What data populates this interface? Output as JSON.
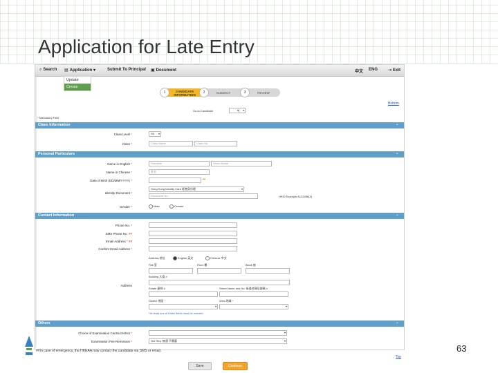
{
  "slide": {
    "title": "Application for Late Entry",
    "page_number": "63"
  },
  "topbar": {
    "search": "Search",
    "application": "Application",
    "submit": "Submit To Principal",
    "document": "Document",
    "lang_zh": "中文",
    "lang_en": "ENG",
    "exit": "Exit"
  },
  "dropdown": {
    "items": [
      "Update",
      "Create"
    ],
    "selected": "Create"
  },
  "stepper": {
    "steps": [
      {
        "num": "1",
        "label": "CANDIDATE INFORMATION"
      },
      {
        "num": "2",
        "label": "SUBJECT"
      },
      {
        "num": "3",
        "label": "REVIEW"
      }
    ]
  },
  "links": {
    "bottom": "Bottom",
    "top": "Top"
  },
  "go_to_candidate": "Go to Candidate",
  "mandatory": "* Mandatory Field",
  "sections": {
    "class_info": "Class Information",
    "personal": "Personal Particulars",
    "contact": "Contact Information",
    "others": "Others"
  },
  "class_info": {
    "class_level_label": "Class Level",
    "class_level_value": "S6",
    "class_label": "Class",
    "class_name_placeholder": "Class Name",
    "class_no_placeholder": "Class No."
  },
  "personal": {
    "name_en_label": "Name in English",
    "surname_placeholder": "Surname",
    "given_placeholder": "Given Name",
    "name_zh_label": "Name in Chinese",
    "name_zh_placeholder": "姓名",
    "dob_label": "Date of Birth (DD/MM/YYYY)",
    "id_doc_label": "Identity Document",
    "id_doc_value": "Hong Kong Identity Card 香港身份證",
    "doc_no_placeholder": "Document No.",
    "hkid_example": "HKID Example A123456(3)",
    "gender_label": "Gender",
    "male": "Male",
    "female": "Female"
  },
  "contact": {
    "phone_label": "Phone No.",
    "sms_label": "SMS Phone No.",
    "email_label": "Email Address",
    "confirm_email_label": "Confirm Email Address",
    "address_label": "Address",
    "address_lang_label": "Address 地址",
    "english": "English 英文",
    "chinese": "Chinese 中文",
    "flat": "Flat 室",
    "floor": "Floor 樓",
    "block": "Block 座",
    "building": "Building 大廈",
    "estate": "Estate 屋邨",
    "street": "Street Name and No. 街道名稱及號碼",
    "district": "District 地區",
    "area": "Area 地域",
    "note": "*At least one of these fields must be entered."
  },
  "others": {
    "exam_centre_label": "Choice of Examination Centre District",
    "fee_remission_label": "Examination Fee Remission",
    "fee_remission_value": "Not Req. 無須 不需要"
  },
  "footer_note": "##In case of emergency, the HKEAA may contact the candidate via SMS or email.",
  "buttons": {
    "save": "Save",
    "continue": "Continue"
  }
}
